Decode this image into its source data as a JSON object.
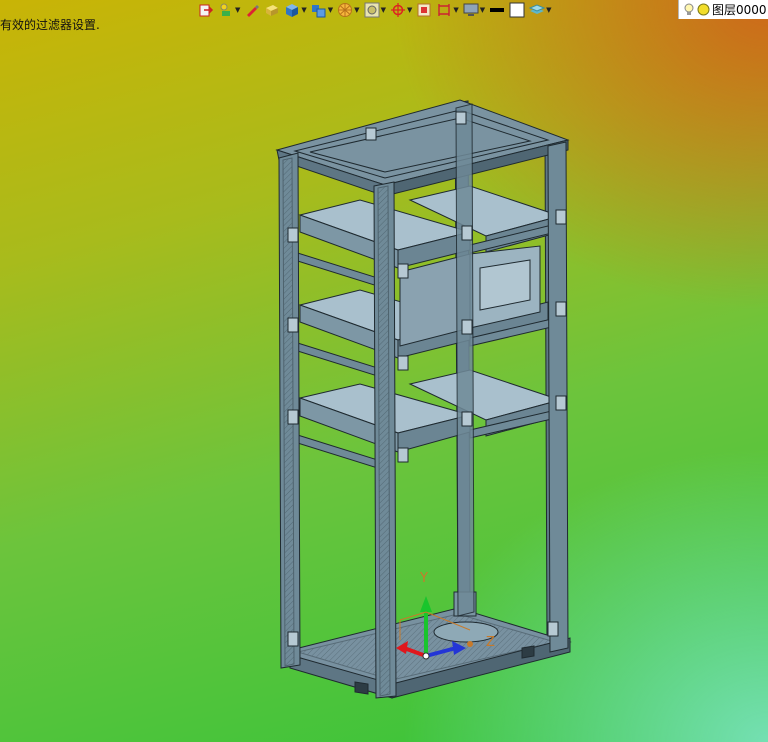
{
  "status_text": "有效的过滤器设置.",
  "toolbar": {
    "items": [
      {
        "icon": "insert-block-icon",
        "dropdown": false
      },
      {
        "icon": "layer-properties-icon",
        "dropdown": true
      },
      {
        "icon": "brush-icon",
        "dropdown": false
      },
      {
        "icon": "solid-box-icon",
        "dropdown": false
      },
      {
        "icon": "blue-cube-icon",
        "dropdown": true
      },
      {
        "icon": "multi-cube-icon",
        "dropdown": true
      },
      {
        "icon": "render-sphere-icon",
        "dropdown": true
      },
      {
        "icon": "render-settings-icon",
        "dropdown": true
      },
      {
        "icon": "ucs-origin-icon",
        "dropdown": true
      },
      {
        "icon": "frame-select-icon",
        "dropdown": false
      },
      {
        "icon": "dimension-icon",
        "dropdown": true
      },
      {
        "icon": "monitor-icon",
        "dropdown": true
      },
      {
        "icon": "lineweight-icon",
        "dropdown": false
      },
      {
        "icon": "color-swatch-icon",
        "dropdown": false
      },
      {
        "icon": "layer-stack-icon",
        "dropdown": true
      }
    ]
  },
  "layer": {
    "name": "图层0000",
    "bulb_icon": "lightbulb-icon",
    "state_icon": "sun-freeze-icon"
  },
  "ucs": {
    "x_label": "Z",
    "y_label": "Y"
  },
  "colors": {
    "frame_stroke": "#1f2a30",
    "frame_fill": "#6f8a98",
    "shelf_fill": "#9fb8c6",
    "axis_y": "#19c52c",
    "axis_x": "#e0171d",
    "axis_z": "#2335d6"
  }
}
